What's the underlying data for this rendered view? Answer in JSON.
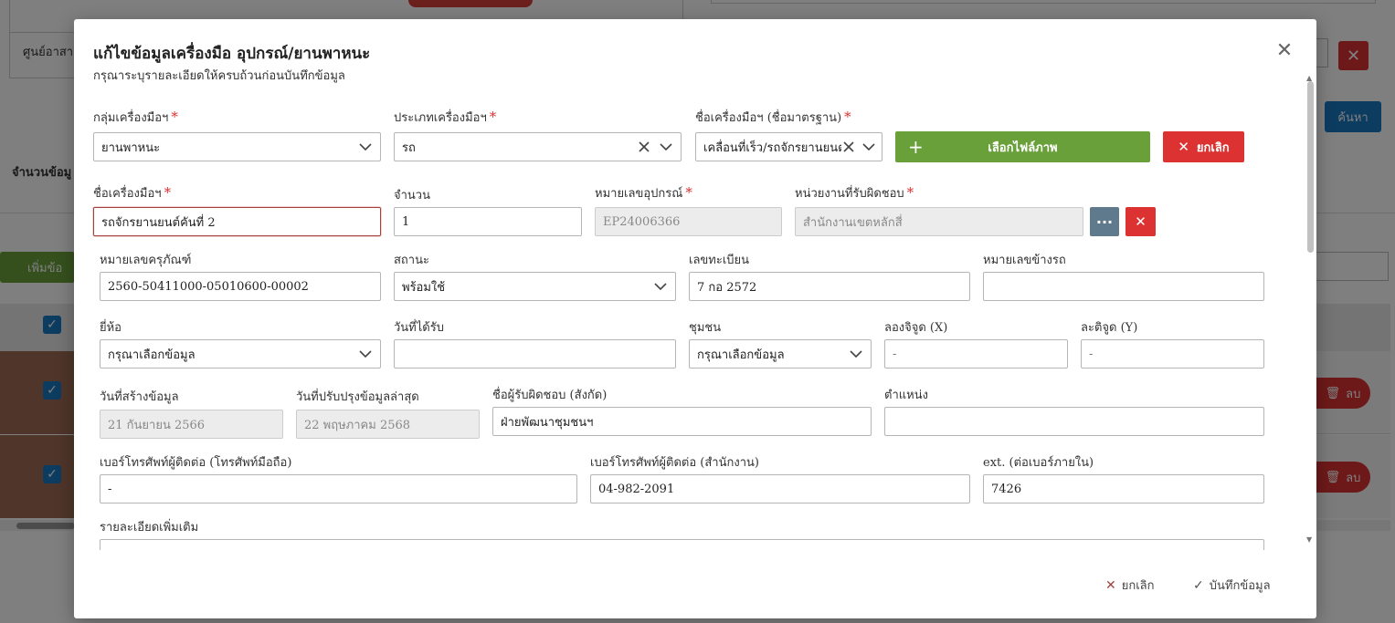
{
  "background": {
    "left_label": "ศูนย์อาสา",
    "count_label": "จำนวนข้อมู",
    "add_button": "เพิ่มข้อ",
    "search_button": "ค้นหา",
    "delete_label": "ลบ"
  },
  "modal": {
    "title": "แก้ไขข้อมูลเครื่องมือ อุปกรณ์/ยานพาหนะ",
    "subtitle": "กรุณาระบุรายละเอียดให้ครบถ้วนก่อนบันทึกข้อมูล"
  },
  "fields": {
    "group": {
      "label": "กลุ่มเครื่องมือฯ",
      "value": "ยานพาหนะ"
    },
    "type": {
      "label": "ประเภทเครื่องมือฯ",
      "value": "รถ"
    },
    "std_name": {
      "label": "ชื่อเครื่องมือฯ (ชื่อมาตรฐาน)",
      "value": "เคลื่อนที่เร็ว/รถจักรยานยนต์"
    },
    "name": {
      "label": "ชื่อเครื่องมือฯ",
      "value": "รถจักรยานยนต์คันที่ 2"
    },
    "quantity": {
      "label": "จำนวน",
      "value": "1"
    },
    "equipment_no": {
      "label": "หมายเลขอุปกรณ์",
      "value": "EP24006366"
    },
    "department": {
      "label": "หน่วยงานที่รับผิดชอบ",
      "value": "สำนักงานเขตหลักสี่"
    },
    "asset_no": {
      "label": "หมายเลขครุภัณฑ์",
      "value": "2560-50411000-05010600-00002"
    },
    "status": {
      "label": "สถานะ",
      "value": "พร้อมใช้"
    },
    "plate": {
      "label": "เลขทะเบียน",
      "value": "7 กอ 2572"
    },
    "side_no": {
      "label": "หมายเลขข้างรถ",
      "value": ""
    },
    "brand": {
      "label": "ยี่ห้อ",
      "value": "กรุณาเลือกข้อมูล"
    },
    "received_date": {
      "label": "วันที่ได้รับ",
      "value": ""
    },
    "community": {
      "label": "ชุมชน",
      "value": "กรุณาเลือกข้อมูล"
    },
    "longitude": {
      "label": "ลองจิจูด (X)",
      "value": "-"
    },
    "latitude": {
      "label": "ละติจูด (Y)",
      "value": "-"
    },
    "created_date": {
      "label": "วันที่สร้างข้อมูล",
      "value": "21 กันยายน 2566"
    },
    "updated_date": {
      "label": "วันที่ปรับปรุงข้อมูลล่าสุด",
      "value": "22 พฤษภาคม 2568"
    },
    "responsible": {
      "label": "ชื่อผู้รับผิดชอบ (สังกัด)",
      "value": "ฝ่ายพัฒนาชุมชนฯ"
    },
    "position": {
      "label": "ตำแหน่ง",
      "value": ""
    },
    "mobile": {
      "label": "เบอร์โทรศัพท์ผู้ติดต่อ (โทรศัพท์มือถือ)",
      "value": "-"
    },
    "office_phone": {
      "label": "เบอร์โทรศัพท์ผู้ติดต่อ (สำนักงาน)",
      "value": "04-982-2091"
    },
    "ext": {
      "label": "ext. (ต่อเบอร์ภายใน)",
      "value": "7426"
    },
    "details": {
      "label": "รายละเอียดเพิ่มเติม",
      "value": ""
    }
  },
  "buttons": {
    "choose_image": "เลือกไฟล์ภาพ",
    "cancel_image": "ยกเลิก",
    "footer_cancel": "ยกเลิก",
    "footer_save": "บันทึกข้อมูล",
    "more": "···"
  }
}
